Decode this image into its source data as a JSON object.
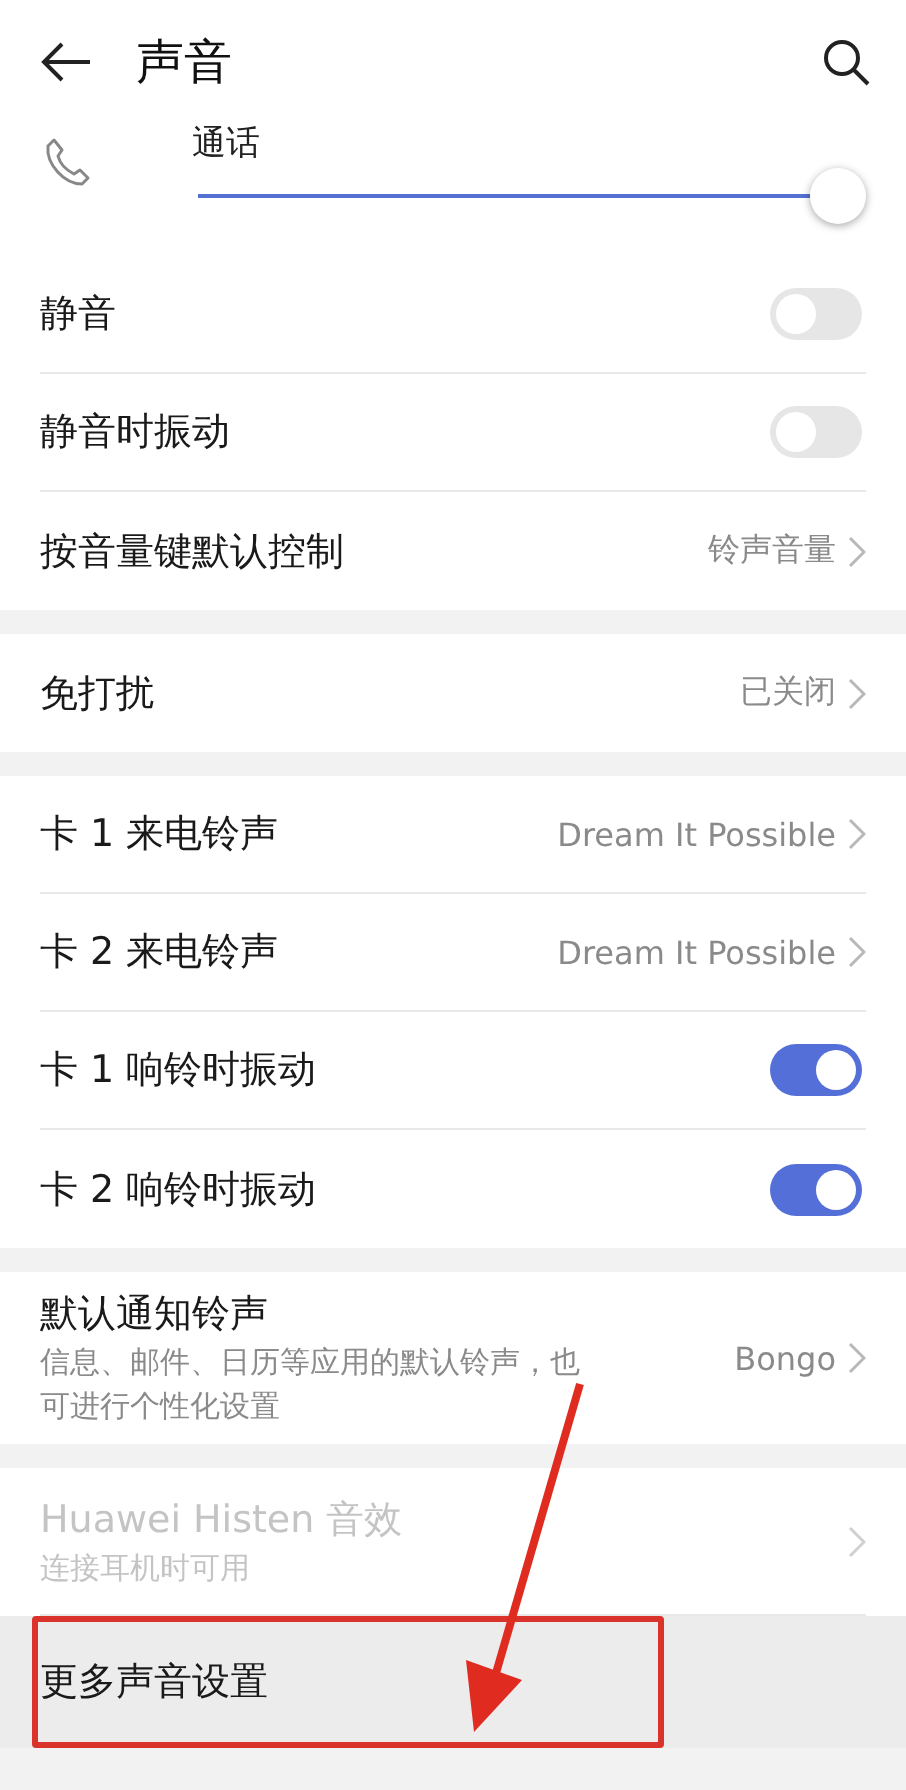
{
  "header": {
    "title": "声音"
  },
  "volume": {
    "label": "通话",
    "level": 1
  },
  "sections": [
    {
      "rows": [
        {
          "kind": "switch",
          "title": "静音",
          "on": false
        },
        {
          "kind": "switch",
          "title": "静音时振动",
          "on": false
        },
        {
          "kind": "link",
          "title": "按音量键默认控制",
          "value": "铃声音量"
        }
      ]
    },
    {
      "rows": [
        {
          "kind": "link",
          "title": "免打扰",
          "value": "已关闭"
        }
      ]
    },
    {
      "rows": [
        {
          "kind": "link",
          "title": "卡 1 来电铃声",
          "value": "Dream It Possible"
        },
        {
          "kind": "link",
          "title": "卡 2 来电铃声",
          "value": "Dream It Possible"
        },
        {
          "kind": "switch",
          "title": "卡 1 响铃时振动",
          "on": true
        },
        {
          "kind": "switch",
          "title": "卡 2 响铃时振动",
          "on": true
        }
      ]
    },
    {
      "rows": [
        {
          "kind": "link",
          "title": "默认通知铃声",
          "subtitle": "信息、邮件、日历等应用的默认铃声，也可进行个性化设置",
          "value": "Bongo"
        }
      ]
    },
    {
      "rows": [
        {
          "kind": "link",
          "title": "Huawei Histen 音效",
          "subtitle": "连接耳机时可用",
          "disabled": true
        },
        {
          "kind": "link",
          "title": "更多声音设置",
          "selected": true,
          "annotated": true
        }
      ]
    }
  ]
}
